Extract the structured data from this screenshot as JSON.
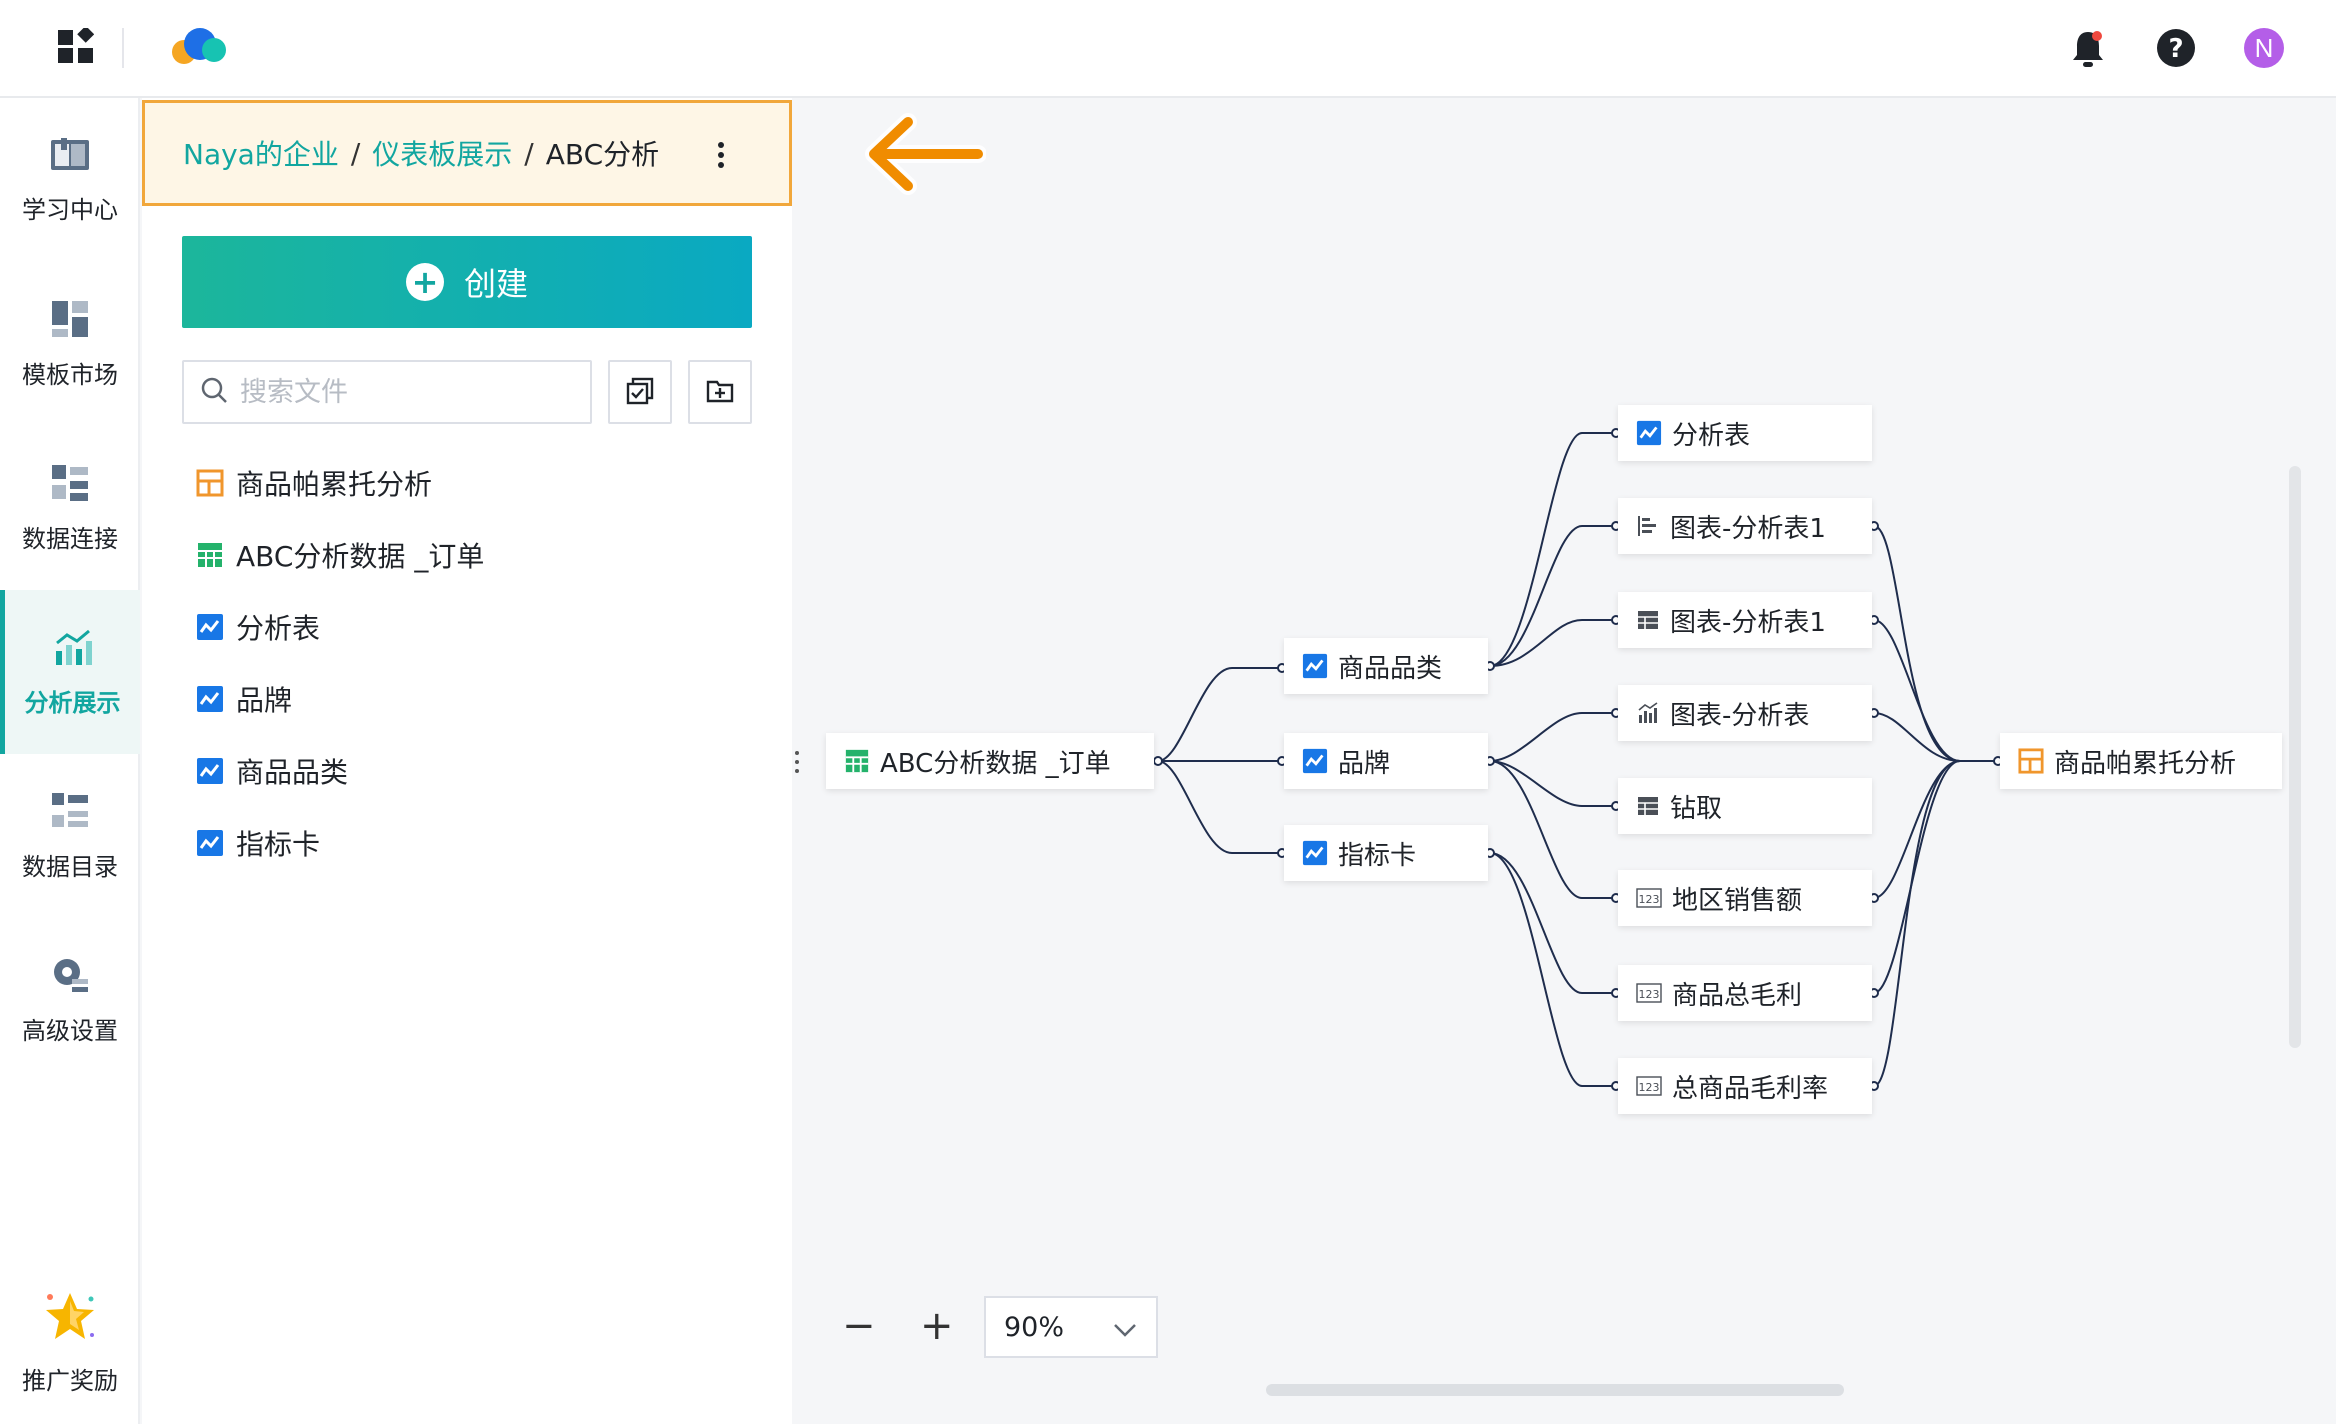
{
  "topbar": {
    "avatar_letter": "N",
    "icons": [
      "apps-icon",
      "cloud-logo-icon",
      "bell-icon",
      "help-icon"
    ]
  },
  "nav": {
    "items": [
      {
        "label": "学习中心",
        "icon": "book-icon"
      },
      {
        "label": "模板市场",
        "icon": "template-icon"
      },
      {
        "label": "数据连接",
        "icon": "data-connect-icon"
      },
      {
        "label": "分析展示",
        "icon": "chart-analysis-icon",
        "active": true
      },
      {
        "label": "数据目录",
        "icon": "catalog-icon"
      },
      {
        "label": "高级设置",
        "icon": "advanced-settings-icon"
      },
      {
        "label": "推广奖励",
        "icon": "star-reward-icon"
      }
    ]
  },
  "breadcrumb": {
    "org": "Naya的企业",
    "folder": "仪表板展示",
    "current": "ABC分析",
    "sep": "/"
  },
  "create_label": "创建",
  "search": {
    "placeholder": "搜索文件"
  },
  "files": [
    {
      "name": "商品帕累托分析",
      "type": "dashboard"
    },
    {
      "name": "ABC分析数据 _订单",
      "type": "table"
    },
    {
      "name": "分析表",
      "type": "analysis"
    },
    {
      "name": "品牌",
      "type": "analysis"
    },
    {
      "name": "商品品类",
      "type": "analysis"
    },
    {
      "name": "指标卡",
      "type": "analysis"
    }
  ],
  "lineage": {
    "source": "ABC分析数据 _订单",
    "analyses": [
      "商品品类",
      "品牌",
      "指标卡"
    ],
    "components": [
      "分析表",
      "图表-分析表1",
      "图表-分析表1",
      "图表-分析表",
      "钻取",
      "地区销售额",
      "商品总毛利",
      "总商品毛利率"
    ],
    "dashboard": "商品帕累托分析"
  },
  "zoom": {
    "minus": "−",
    "plus": "+",
    "value": "90%"
  },
  "colors": {
    "accent": "#12a6a0",
    "highlight_border": "#f1a73b",
    "arrow": "#f08c00"
  }
}
